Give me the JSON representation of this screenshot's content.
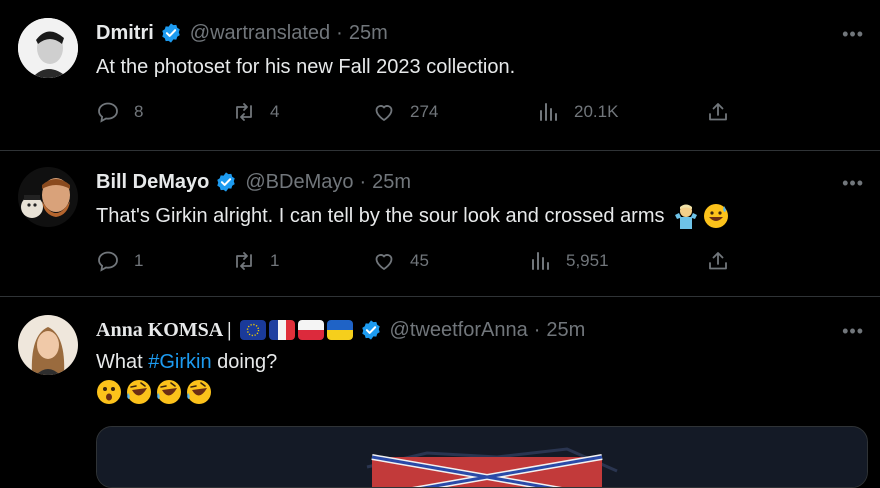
{
  "tweets": [
    {
      "name": "Dmitri",
      "handle": "@wartranslated",
      "time": "25m",
      "text": "At the photoset for his new Fall 2023 collection.",
      "replies": "8",
      "retweets": "4",
      "likes": "274",
      "views": "20.1K"
    },
    {
      "name": "Bill DeMayo",
      "handle": "@BDeMayo",
      "time": "25m",
      "text": "That's Girkin alright.  I can tell by the sour look and crossed arms",
      "replies": "1",
      "retweets": "1",
      "likes": "45",
      "views": "5,951"
    },
    {
      "name": "Anna KOMSA |",
      "handle": "@tweetforAnna",
      "time": "25m",
      "text_before": "What ",
      "hashtag": "#Girkin",
      "text_after": " doing?"
    }
  ],
  "separator": "·",
  "more_label": "•••",
  "colors": {
    "background": "#000000",
    "text": "#e7e9ea",
    "muted": "#71767b",
    "accent": "#1d9bf0",
    "verified": "#1d9bf0",
    "divider": "#2f3336"
  },
  "icons": [
    "reply-icon",
    "retweet-icon",
    "like-icon",
    "views-icon",
    "share-icon",
    "verified-badge-icon",
    "more-icon"
  ]
}
